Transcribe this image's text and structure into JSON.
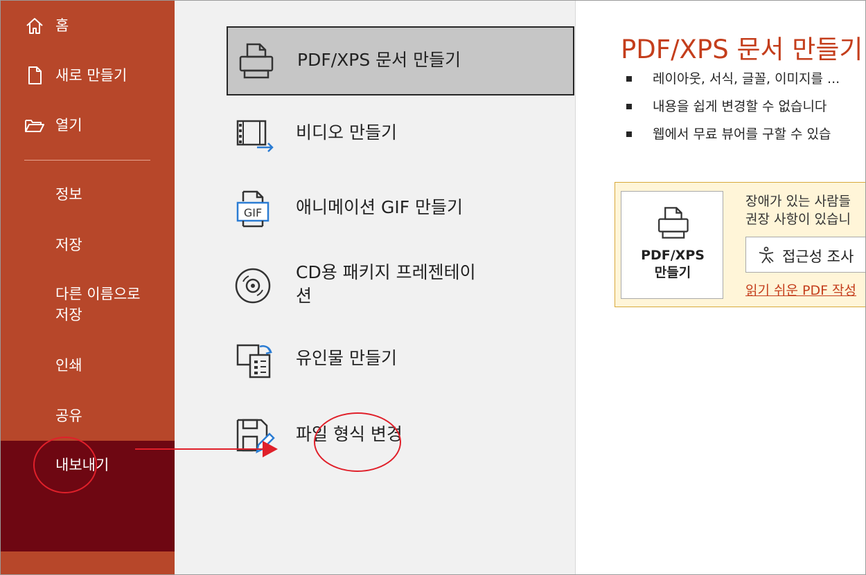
{
  "sidebar": {
    "home_label": "홈",
    "new_label": "새로 만들기",
    "open_label": "열기",
    "info_label": "정보",
    "save_label": "저장",
    "save_as_label_line1": "다른 이름으로",
    "save_as_label_line2": "저장",
    "print_label": "인쇄",
    "share_label": "공유",
    "export_label": "내보내기",
    "background_color": "#b7472a",
    "active_color": "#6e0712"
  },
  "options": [
    {
      "label": "PDF/XPS 문서 만들기",
      "icon": "printer-icon",
      "selected": true
    },
    {
      "label": "비디오 만들기",
      "icon": "video-icon"
    },
    {
      "label": "애니메이션 GIF 만들기",
      "icon": "gif-icon",
      "icon_text": "GIF"
    },
    {
      "label_line1": "CD용 패키지 프레젠테이",
      "label_line2": "션",
      "icon": "cd-icon"
    },
    {
      "label": "유인물 만들기",
      "icon": "handout-icon"
    },
    {
      "label": "파일 형식 변경",
      "icon": "file-type-change-icon"
    }
  ],
  "detail": {
    "title": "PDF/XPS 문서 만들기",
    "bullets": [
      "레이아웃, 서식, 글꼴, 이미지를 ...",
      "내용을 쉽게 변경할 수 없습니다",
      "웹에서 무료 뷰어를 구할 수 있습"
    ],
    "title_color": "#c43e1c"
  },
  "notice": {
    "button_label_line1": "PDF/XPS",
    "button_label_line2": "만들기",
    "text_line1": "장애가 있는 사람들",
    "text_line2": "권장 사항이 있습니",
    "accessibility_button": "접근성 조사",
    "link": "읽기 쉬운 PDF 작성"
  },
  "annotations": {
    "color": "#e0202a"
  }
}
